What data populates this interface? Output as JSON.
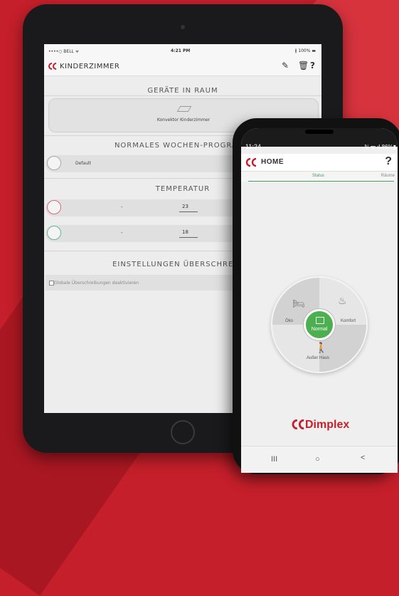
{
  "tablet": {
    "status": {
      "carrier": "••••○ BELL ᯤ",
      "time": "4:21 PM",
      "battery": "∦ 100% ▬"
    },
    "header": {
      "title": "KINDERZIMMER",
      "edit_icon": "✎",
      "delete_icon": "🗑",
      "help_label": "?"
    },
    "sections": {
      "devices_title": "GERÄTE IN RAUM",
      "device_name": "Konvektor Kinderzimmer",
      "weekly_title": "NORMALES WOCHEN-PROGRAMM",
      "weekly_value": "Default",
      "temp_title": "TEMPERATUR",
      "temp_rows": [
        {
          "dash": "-",
          "value": "23"
        },
        {
          "dash": "-",
          "value": "18"
        }
      ],
      "override_title": "EINSTELLUNGEN ÜBERSCHREIBEN",
      "override_checkbox": "Globale Überschreibungen deaktivieren"
    }
  },
  "phone": {
    "status": {
      "time": "11:24",
      "signal": "ℕ ᯤ.ıl 86%▮"
    },
    "header": {
      "title": "HOME",
      "help_label": "?"
    },
    "tabs": {
      "status": "Status",
      "rooms": "Räume"
    },
    "dial": {
      "center": "Normal",
      "left": "Öko",
      "right": "Komfort",
      "bottom": "Außer Haus"
    },
    "brand": "Dimplex",
    "nav": {
      "recent": "III",
      "home": "○",
      "back": "<"
    }
  },
  "colors": {
    "brand_red": "#c41f2a",
    "accent_green": "#4caf50"
  }
}
